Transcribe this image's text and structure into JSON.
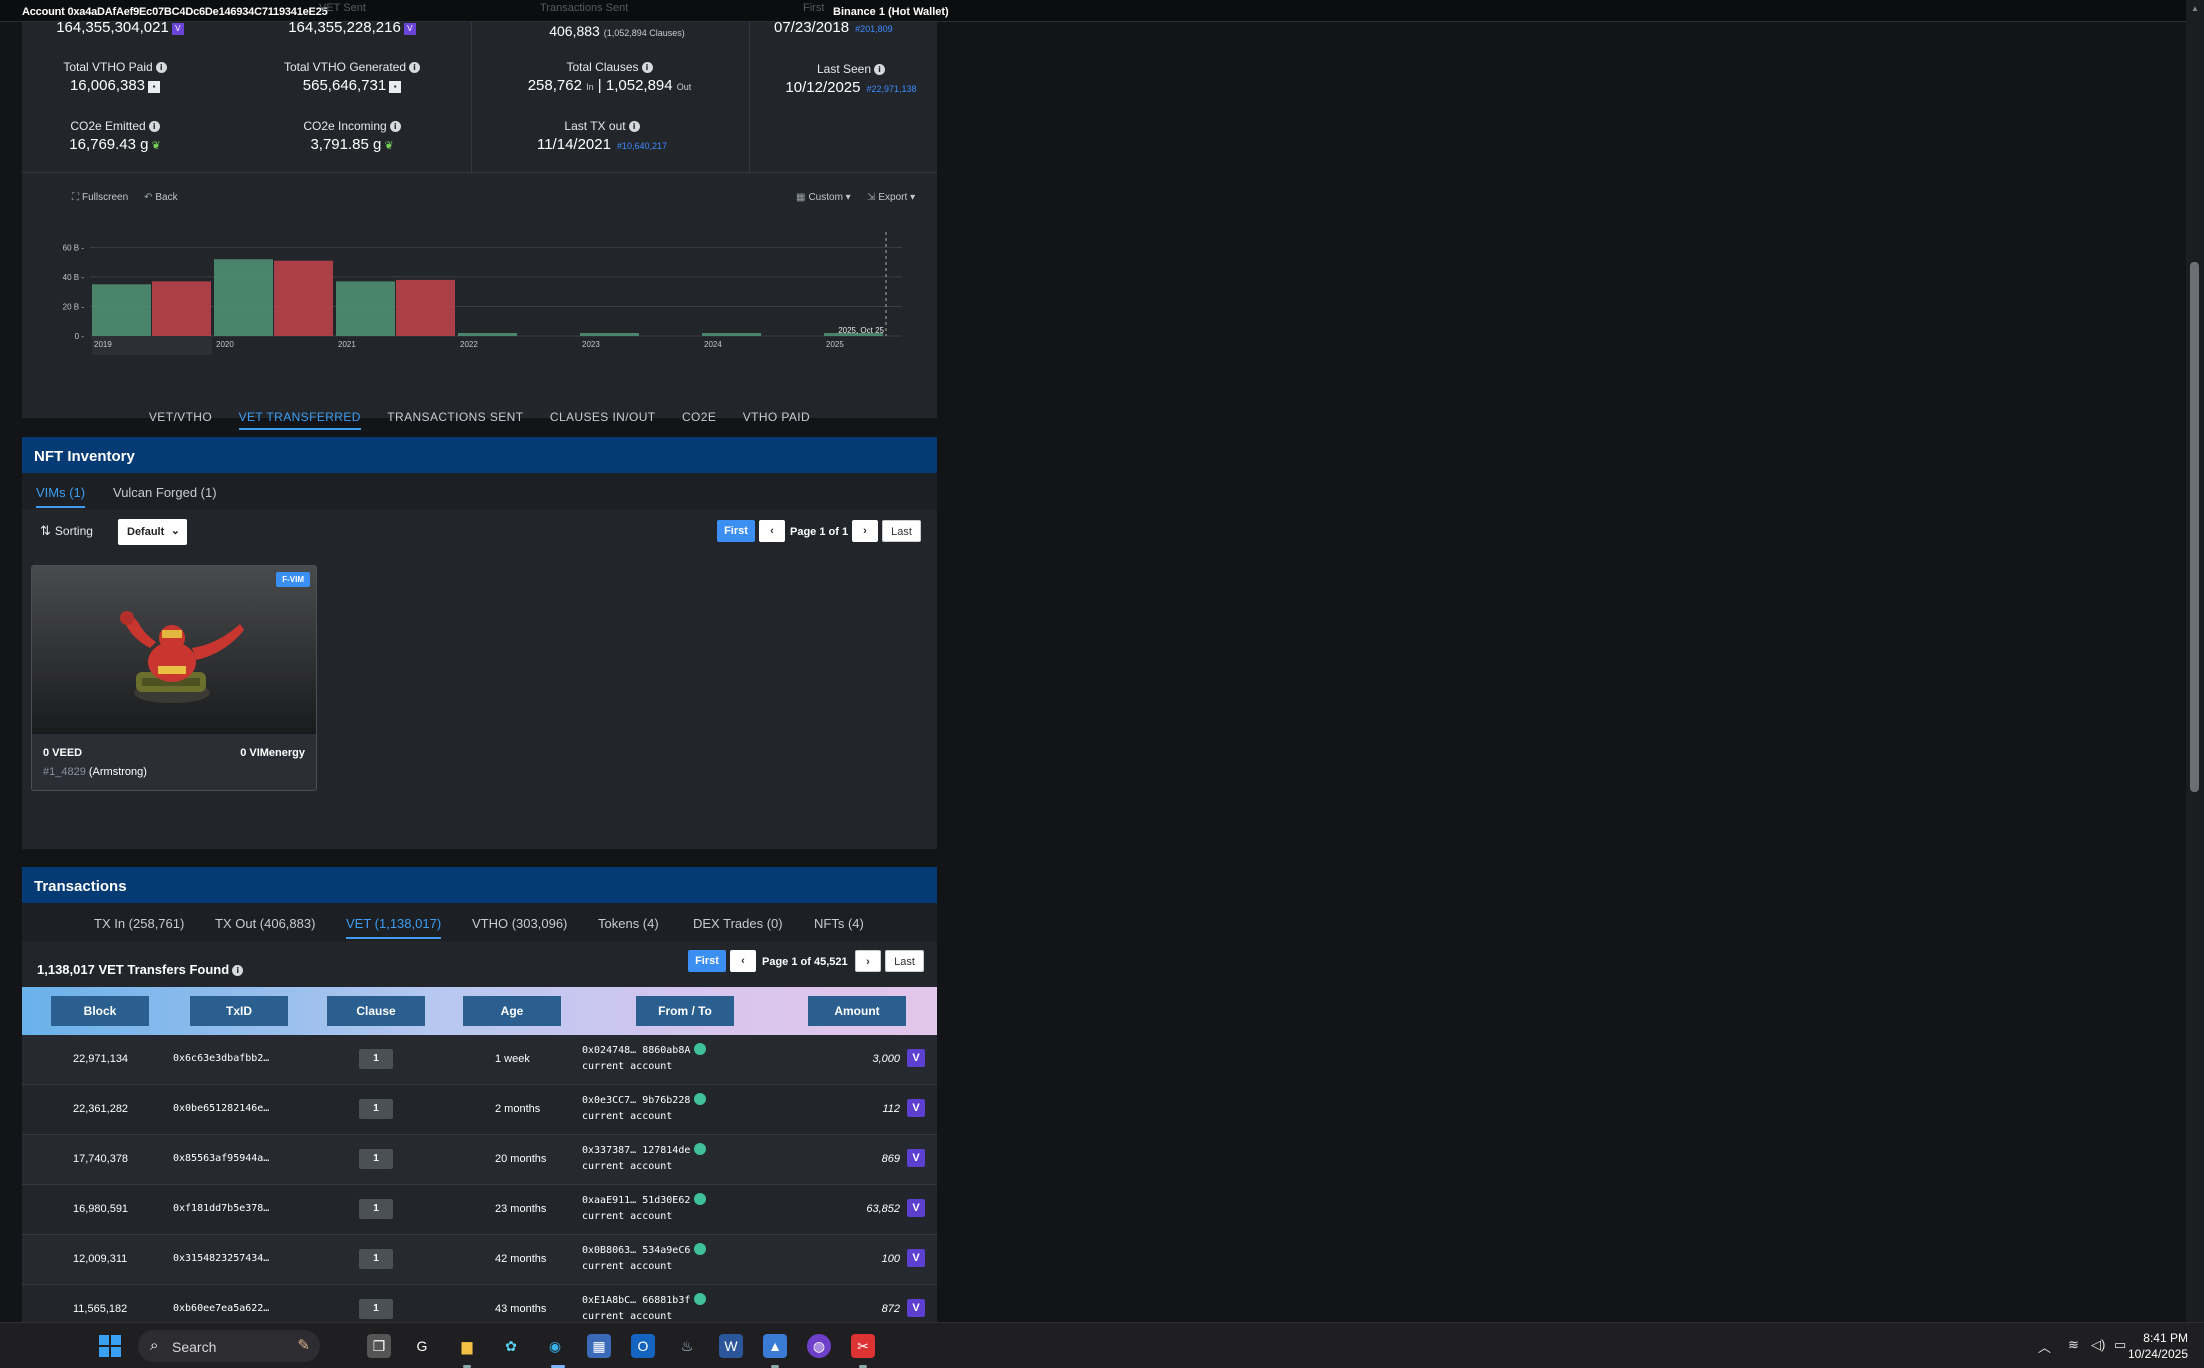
{
  "header": {
    "account": "Account 0xa4aDAfAef9Ec07BC4Dc6De146934C7119341eE25",
    "wallet_name": "Binance 1 (Hot Wallet)"
  },
  "stats": {
    "ghost_labels": [
      "VET Sent",
      "Transactions Sent",
      "First"
    ],
    "row0": [
      {
        "value": "164,355,304,021"
      },
      {
        "value": "164,355,228,216"
      },
      {
        "value": "406,883",
        "extra": "(1,052,894 Clauses)"
      },
      {
        "value": "07/23/2018",
        "block": "#201,809"
      }
    ],
    "row1": [
      {
        "label": "Total VTHO Paid",
        "value": "16,006,383"
      },
      {
        "label": "Total VTHO Generated",
        "value": "565,646,731"
      },
      {
        "label": "Total Clauses",
        "in_value": "258,762",
        "in_unit": "In",
        "sep": "|",
        "out_value": "1,052,894",
        "out_unit": "Out"
      },
      {
        "label": "Last Seen",
        "value": "10/12/2025",
        "block": "#22,971,138"
      }
    ],
    "row2": [
      {
        "label": "CO2e Emitted",
        "value": "16,769.43 g"
      },
      {
        "label": "CO2e Incoming",
        "value": "3,791.85 g"
      },
      {
        "label": "Last TX out",
        "value": "11/14/2021",
        "block": "#10,640,217"
      }
    ]
  },
  "chart_controls": {
    "fullscreen": "Fullscreen",
    "back": "Back",
    "custom": "Custom",
    "export": "Export"
  },
  "chart_data": {
    "type": "bar",
    "categories": [
      "2019",
      "2020",
      "2021",
      "2022",
      "2023",
      "2024",
      "2025"
    ],
    "series": [
      {
        "values": [
          35,
          52,
          37,
          1,
          1,
          1,
          1
        ],
        "color": "#4f8f72"
      },
      {
        "values": [
          37,
          51,
          38,
          0,
          0,
          0,
          0
        ],
        "color": "#b9434b"
      }
    ],
    "y_ticks": [
      "0",
      "20 B",
      "40 B",
      "60 B"
    ],
    "ylim": [
      0,
      65
    ],
    "annotation": "2025, Oct 25",
    "grid": true
  },
  "chart_tabs": [
    "VET/VTHO",
    "VET TRANSFERRED",
    "TRANSACTIONS SENT",
    "CLAUSES IN/OUT",
    "CO2E",
    "VTHO PAID"
  ],
  "nft": {
    "title": "NFT Inventory",
    "tabs": [
      "VIMs (1)",
      "Vulcan Forged (1)"
    ],
    "sorting_label": "Sorting",
    "sort_value": "Default",
    "pager": {
      "first": "First",
      "text": "Page 1 of 1",
      "last": "Last"
    },
    "card": {
      "tag": "F-VIM",
      "veed": "0 VEED",
      "vimenergy": "0 VIMenergy",
      "token_id": "#1_4829",
      "name": "(Armstrong)"
    }
  },
  "transactions": {
    "title": "Transactions",
    "tabs": [
      "TX In (258,761)",
      "TX Out (406,883)",
      "VET (1,138,017)",
      "VTHO (303,096)",
      "Tokens (4)",
      "DEX Trades (0)",
      "NFTs (4)"
    ],
    "found": "1,138,017 VET Transfers Found",
    "pager": {
      "first": "First",
      "text": "Page 1 of 45,521",
      "last": "Last"
    },
    "columns": [
      "Block",
      "TxID",
      "Clause",
      "Age",
      "From / To",
      "Amount"
    ],
    "rows": [
      {
        "block": "22,971,134",
        "txid": "0x6c63e3dbafbb2…",
        "clause": "1",
        "age": "1 week",
        "from": "0x024748… 8860ab8A",
        "to": "current account",
        "amount": "3,000"
      },
      {
        "block": "22,361,282",
        "txid": "0x0be651282146e…",
        "clause": "1",
        "age": "2 months",
        "from": "0x0e3CC7… 9b76b228",
        "to": "current account",
        "amount": "112"
      },
      {
        "block": "17,740,378",
        "txid": "0x85563af95944a…",
        "clause": "1",
        "age": "20 months",
        "from": "0x337387… 127814de",
        "to": "current account",
        "amount": "869"
      },
      {
        "block": "16,980,591",
        "txid": "0xf181dd7b5e378…",
        "clause": "1",
        "age": "23 months",
        "from": "0xaaE911… 51d30E62",
        "to": "current account",
        "amount": "63,852"
      },
      {
        "block": "12,009,311",
        "txid": "0x3154823257434…",
        "clause": "1",
        "age": "42 months",
        "from": "0x0B8063… 534a9eC6",
        "to": "current account",
        "amount": "100"
      },
      {
        "block": "11,565,182",
        "txid": "0xb60ee7ea5a622…",
        "clause": "1",
        "age": "43 months",
        "from": "0xE1A8bC… 66881b3f",
        "to": "current account",
        "amount": "872"
      }
    ]
  },
  "taskbar": {
    "search_placeholder": "Search",
    "time": "8:41 PM",
    "date": "10/24/2025"
  }
}
